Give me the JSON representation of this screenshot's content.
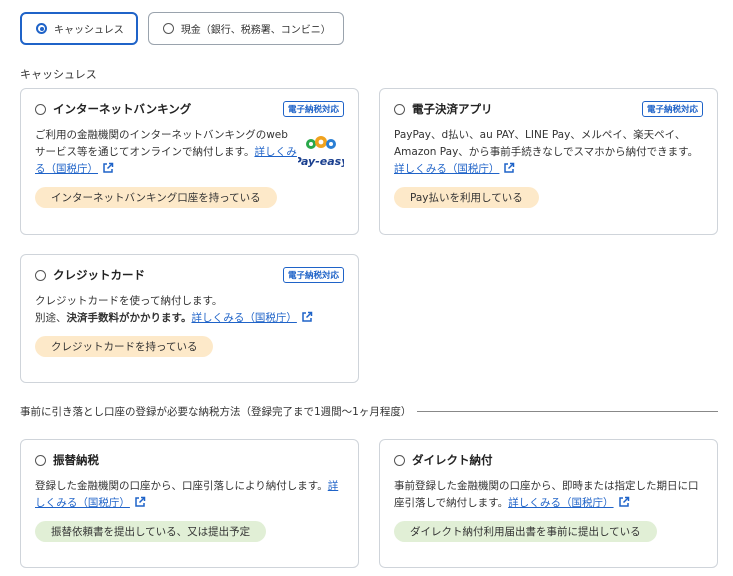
{
  "segments": [
    {
      "label": "キャッシュレス",
      "selected": true
    },
    {
      "label": "現金（銀行、税務署、コンビニ）",
      "selected": false
    }
  ],
  "section_cashless": "キャッシュレス",
  "cards": {
    "internet_banking": {
      "title": "インターネットバンキング",
      "badge": "電子納税対応",
      "desc": "ご利用の金融機関のインターネットバンキングのwebサービス等を通じてオンラインで納付します。",
      "link": "詳しくみる（国税庁）",
      "pill": "インターネットバンキング口座を持っている",
      "logo_text": "Pay-easy"
    },
    "payment_app": {
      "title": "電子決済アプリ",
      "badge": "電子納税対応",
      "desc": "PayPay、d払い、au PAY、LINE Pay、メルペイ、楽天ペイ、 Amazon Pay、から事前手続きなしでスマホから納付できます。",
      "link": "詳しくみる（国税庁）",
      "pill": "Pay払いを利用している"
    },
    "credit_card": {
      "title": "クレジットカード",
      "badge": "電子納税対応",
      "desc1": "クレジットカードを使って納付します。",
      "desc2_pre": "別途、",
      "desc2_bold": "決済手数料がかかります。",
      "link": "詳しくみる（国税庁）",
      "pill": "クレジットカードを持っている"
    },
    "furikae": {
      "title": "振替納税",
      "desc": "登録した金融機関の口座から、口座引落しにより納付します。",
      "link": "詳しくみる（国税庁）",
      "pill": "振替依頼書を提出している、又は提出予定"
    },
    "direct": {
      "title": "ダイレクト納付",
      "desc": "事前登録した金融機関の口座から、即時または指定した期日に口座引落しで納付します。",
      "link": "詳しくみる（国税庁）",
      "pill": "ダイレクト納付利用届出書を事前に提出している"
    }
  },
  "divider_text": "事前に引き落とし口座の登録が必要な納税方法（登録完了まで1週間〜1ヶ月程度）",
  "colors": {
    "accent": "#1f63c8",
    "pill_orange": "#fde9c9",
    "pill_green": "#e1efd6"
  }
}
